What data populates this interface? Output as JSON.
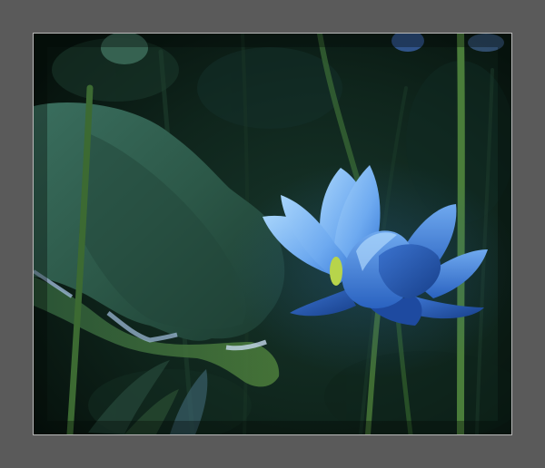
{
  "photo": {
    "subject": "blue-lotus-flower",
    "colors": {
      "mat": "#5a5a5a",
      "frame_border": "#b9b9b9",
      "background_dark": "#0a1a14",
      "background_mid": "#10261d",
      "leaf": "#2f5a4c",
      "leaf_edge": "#8aa9c4",
      "stem": "#3f6a38",
      "petal_light": "#8fc4f2",
      "petal_mid": "#4f8fe0",
      "petal_dark": "#1f4f9e",
      "stamen": "#b7d44b"
    }
  }
}
